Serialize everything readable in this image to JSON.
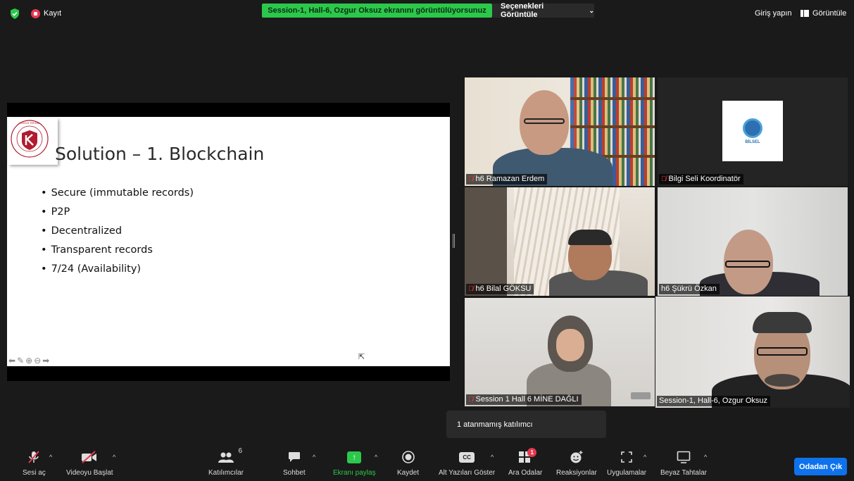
{
  "topbar": {
    "rec_label": "Kayıt",
    "share_banner": "Session-1, Hall-6, Ozgur Oksuz ekranını görüntülüyorsunuz",
    "view_options": "Seçenekleri Görüntüle",
    "login": "Giriş yapın",
    "view": "Görüntüle"
  },
  "slide": {
    "title": "Solution – 1. Blockchain",
    "bullets": [
      "Secure (immutable records)",
      "P2P",
      "Decentralized",
      "Transparent records",
      "7/24 (Availability)"
    ],
    "logo_text": "KONYA TEKNİK ÜNİVERSİTESİ"
  },
  "participants": [
    {
      "name": "h6 Ramazan Erdem",
      "muted": true
    },
    {
      "name": "Bilgi Seli Koordinatör",
      "muted": true,
      "logo_text": "BİLSEL"
    },
    {
      "name": "h6 Bilal GÖKSU",
      "muted": true
    },
    {
      "name": "h6 Şükrü Özkan",
      "muted": false
    },
    {
      "name": "Session 1 Hall 6 MİNE DAĞLI",
      "muted": true
    },
    {
      "name": "Session-1, Hall-6, Ozgur Oksuz",
      "muted": false,
      "speaking": true
    }
  ],
  "tooltip": "1 atanmamış katılımcı",
  "toolbar": {
    "unmute": "Sesi aç",
    "start_video": "Videoyu Başlat",
    "participants": "Katılımcılar",
    "participants_count": "6",
    "chat": "Sohbet",
    "share_screen": "Ekranı paylaş",
    "record": "Kaydet",
    "captions": "Alt Yazıları Göster",
    "captions_icon": "CC",
    "breakout": "Ara Odalar",
    "breakout_badge": "1",
    "reactions": "Reaksiyonlar",
    "apps": "Uygulamalar",
    "whiteboard": "Beyaz Tahtalar",
    "leave": "Odadan Çık"
  },
  "colors": {
    "share_green": "#2cc84b",
    "leave_blue": "#0e72ed",
    "record_red": "#e8384f",
    "speaker_highlight": "#b6e05f"
  }
}
